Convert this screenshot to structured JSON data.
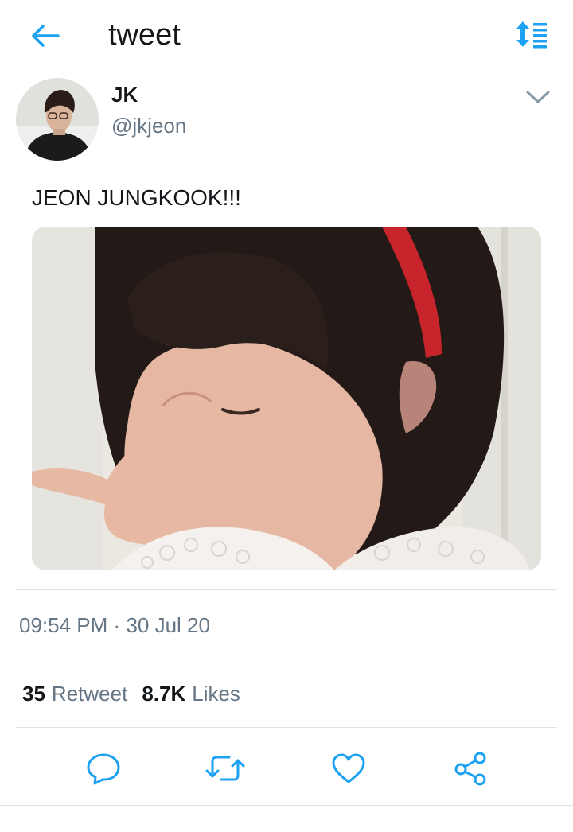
{
  "header": {
    "title": "tweet",
    "back_icon": "arrow-left-icon",
    "sort_icon": "sort-list-icon",
    "accent_color": "#1da1f2"
  },
  "tweet": {
    "author_name": "JK",
    "author_handle": "@jkjeon",
    "text": "JEON JUNGKOOK!!!",
    "time": "09:54 PM",
    "separator": "·",
    "date": "30 Jul 20"
  },
  "stats": {
    "retweets_count": "35",
    "retweets_label": "Retweet",
    "likes_count": "8.7K",
    "likes_label": "Likes"
  },
  "actions": {
    "reply_icon": "reply-icon",
    "retweet_icon": "retweet-icon",
    "like_icon": "heart-icon",
    "share_icon": "share-icon",
    "icon_color": "#1da1f2"
  },
  "colors": {
    "text_primary": "#14171a",
    "text_secondary": "#657786",
    "divider": "#dfe3e7"
  }
}
